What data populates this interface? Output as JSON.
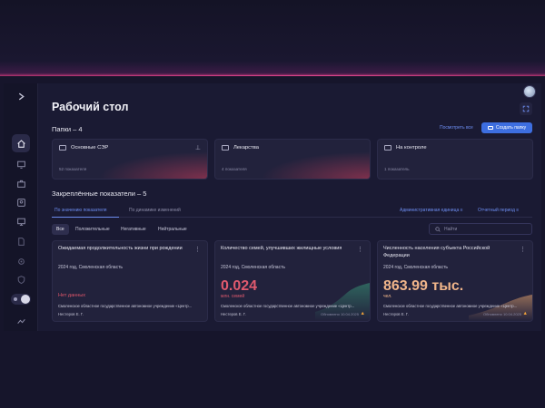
{
  "page": {
    "title": "Рабочий стол"
  },
  "sidebar": {
    "items": [
      {
        "icon": "home-icon",
        "active": true
      },
      {
        "icon": "monitor-chart-icon",
        "active": false
      },
      {
        "icon": "briefcase-icon",
        "active": false
      },
      {
        "icon": "users-icon",
        "active": false
      },
      {
        "icon": "desktop-icon",
        "active": false
      },
      {
        "icon": "document-icon",
        "active": false
      },
      {
        "icon": "gear-icon",
        "active": false
      },
      {
        "icon": "shield-icon",
        "active": false
      }
    ],
    "expand_icon": "chevron-right-icon"
  },
  "folders_section": {
    "title": "Папки – 4",
    "view_all": "Посмотреть все",
    "create_label": "Создать папку",
    "items": [
      {
        "name": "Основные СЭР",
        "count": "52 показателя",
        "pinned": true
      },
      {
        "name": "Лекарства",
        "count": "4 показателя",
        "pinned": false
      },
      {
        "name": "На контроле",
        "count": "1 показатель",
        "pinned": false
      }
    ]
  },
  "pinned_section": {
    "title": "Закреплённые показатели – 5",
    "tabs": [
      {
        "label": "По значению показателя",
        "active": true
      },
      {
        "label": "По динамике изменений",
        "active": false
      }
    ],
    "filter_unit": "Административная единица",
    "filter_period": "Отчетный период",
    "chips": [
      {
        "label": "Все",
        "active": true
      },
      {
        "label": "Положительные",
        "active": false
      },
      {
        "label": "Негативные",
        "active": false
      },
      {
        "label": "Нейтральные",
        "active": false
      }
    ],
    "search_placeholder": "Найти",
    "cards": [
      {
        "title": "Ожидаемая продолжительность жизни при рождении",
        "subtitle": "2024 год, Смоленская область",
        "value": "",
        "unit": "",
        "no_data": "Нет данных",
        "org": "Смоленское областное государственное автономное учреждение «Центр...",
        "author": "Нестеров Е. Г.",
        "updated": "",
        "warning": false
      },
      {
        "title": "Количество семей, улучшивших жилищные условия",
        "subtitle": "2024 год, Смоленская область",
        "value": "0.024",
        "unit": "млн. семей",
        "no_data": "",
        "org": "Смоленское областное государственное автономное учреждение «Центр...",
        "author": "Нестеров Е. Г.",
        "updated": "Обновлено 10.04.2025",
        "warning": true
      },
      {
        "title": "Численность населения субъекта Российской Федерации",
        "subtitle": "2024 год, Смоленская область",
        "value": "863.99 тыс.",
        "unit": "чел.",
        "no_data": "",
        "org": "Смоленское областное государственное автономное учреждение «Центр...",
        "author": "Нестеров Е. Г.",
        "updated": "Обновлено 10.04.2025",
        "warning": true
      }
    ]
  },
  "colors": {
    "accent": "#3d6ee0",
    "link": "#6d8df0",
    "value_negative": "#e0566a",
    "value_positive": "#e05a6e",
    "value_neutral": "#f0b58a"
  }
}
